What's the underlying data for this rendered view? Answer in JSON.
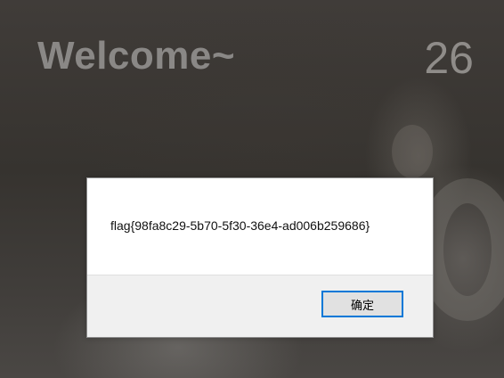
{
  "page": {
    "welcome_text": "Welcome~",
    "counter": "26"
  },
  "dialog": {
    "message": "flag{98fa8c29-5b70-5f30-36e4-ad006b259686}",
    "ok_label": "确定",
    "accent_color": "#0078d7"
  }
}
